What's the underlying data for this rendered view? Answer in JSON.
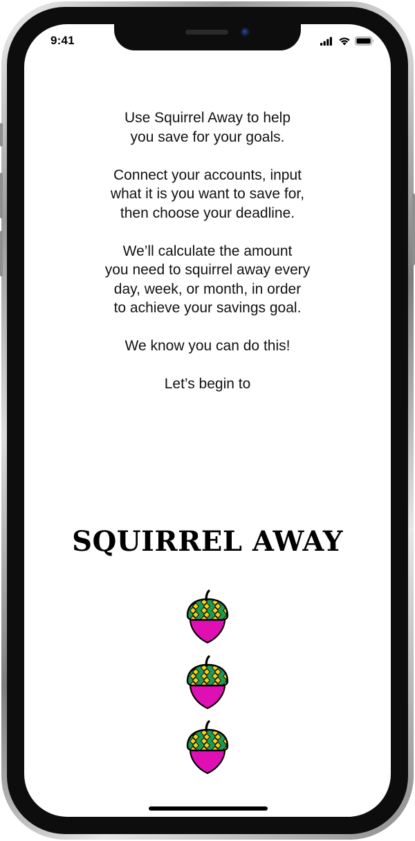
{
  "status_bar": {
    "time": "9:41",
    "icons": [
      "cellular-signal-icon",
      "wifi-icon",
      "battery-icon"
    ]
  },
  "intro": {
    "paragraphs": [
      [
        "Use Squirrel Away to help",
        "you save for your goals."
      ],
      [
        "Connect your accounts, input",
        "what it is you want to save for,",
        "then choose your deadline."
      ],
      [
        "We’ll calculate the amount",
        "you need to squirrel away every",
        "day, week, or month, in order",
        "to achieve your savings goal."
      ],
      [
        "We know you can do this!"
      ],
      [
        "Let’s begin to"
      ]
    ]
  },
  "brand": {
    "title": "SQUIRREL AWAY"
  },
  "acorns": {
    "icon": "acorn-icon",
    "count": 3,
    "cap_green": "#1f9a56",
    "cap_yellow": "#f2d21b",
    "body_color": "#e00fb4",
    "outline": "#000000"
  },
  "colors": {
    "background": "#ffffff",
    "text": "#111111"
  }
}
